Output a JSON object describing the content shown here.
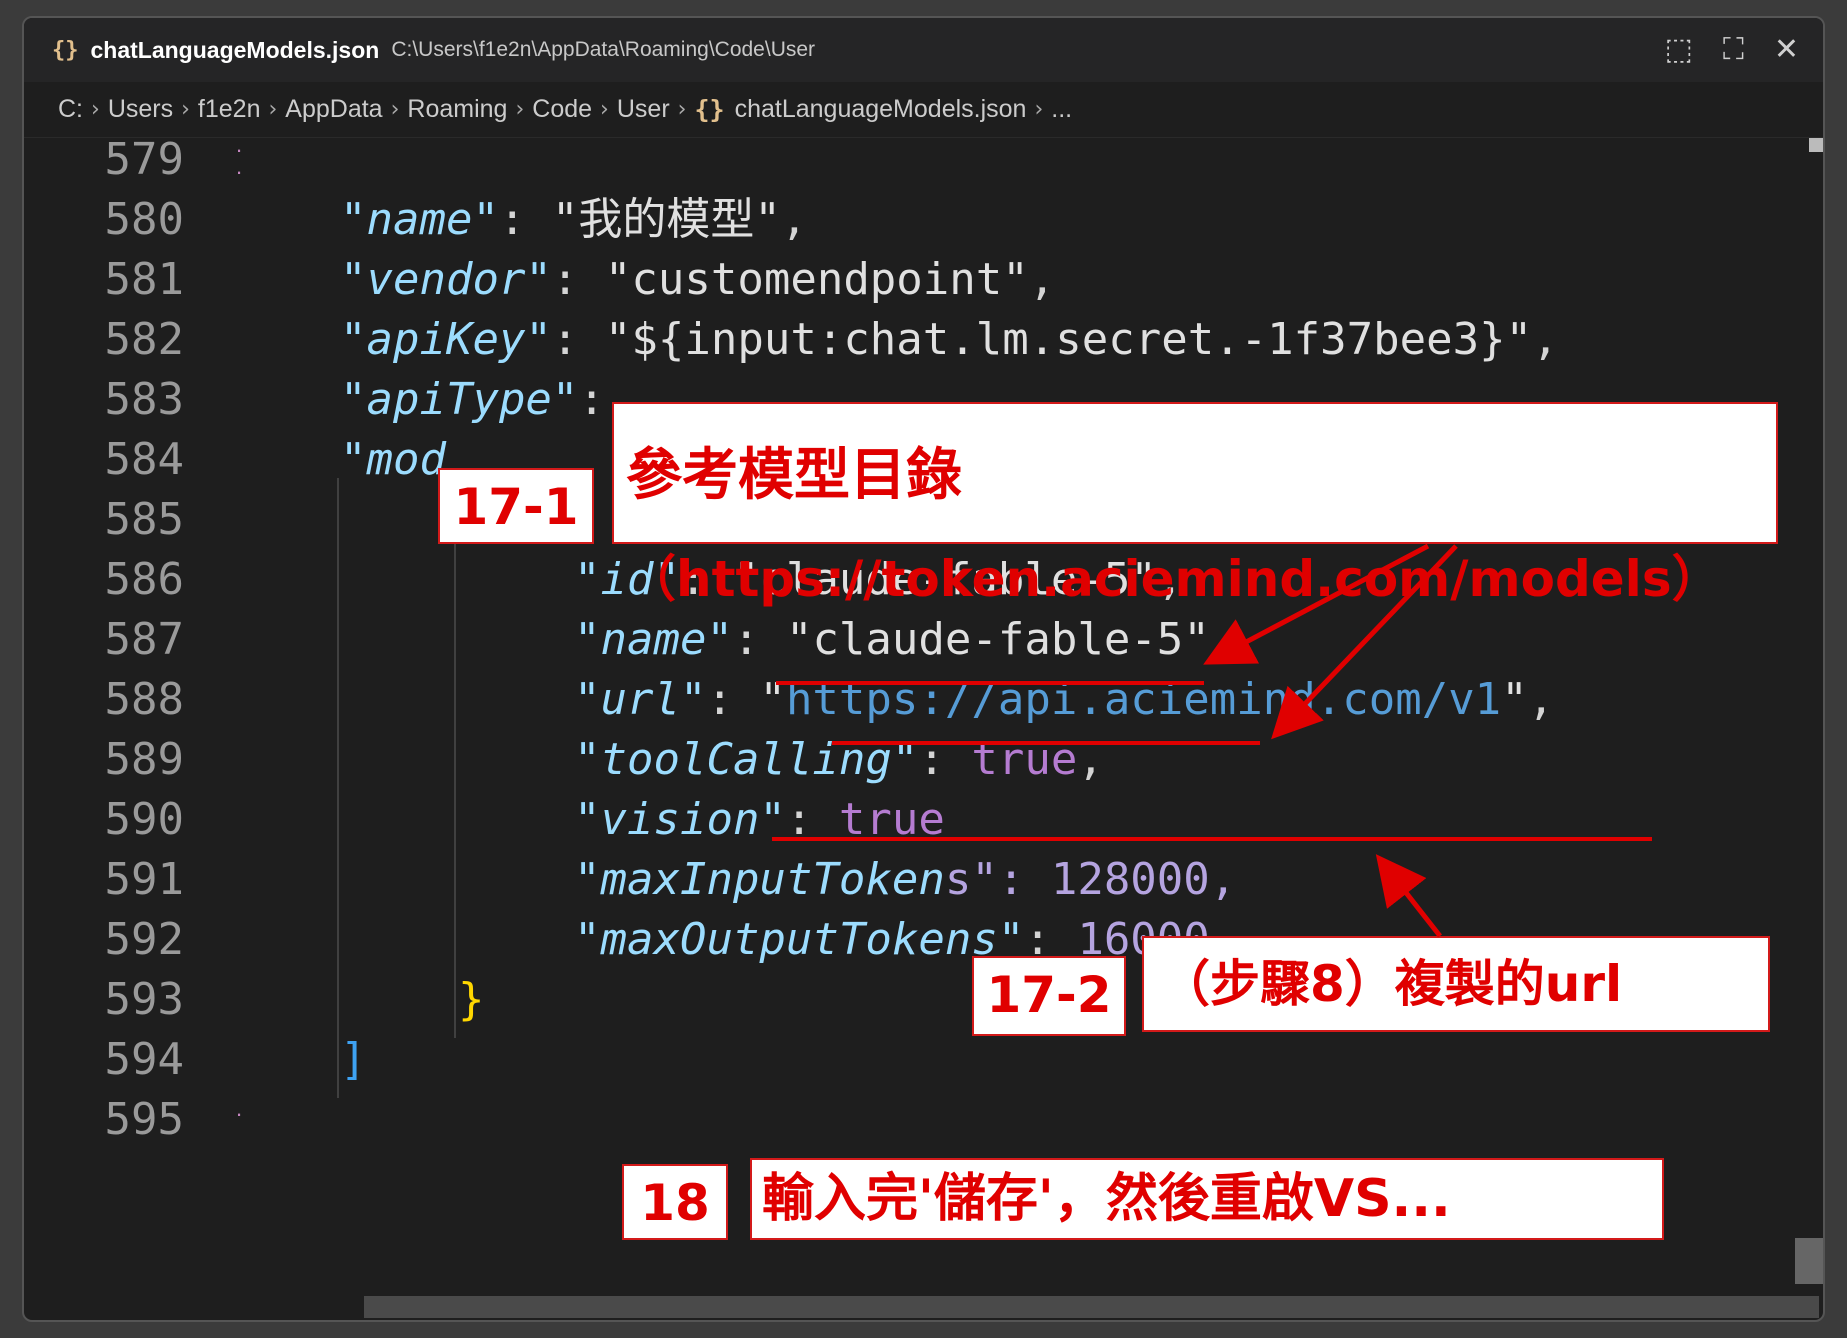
{
  "window": {
    "title_icon": "{}",
    "filename": "chatLanguageModels.json",
    "path": "C:\\Users\\f1e2n\\AppData\\Roaming\\Code\\User",
    "actions": [
      "select-region-icon",
      "fullscreen-icon",
      "close-icon"
    ]
  },
  "breadcrumb": {
    "items": [
      "C:",
      "Users",
      "f1e2n",
      "AppData",
      "Roaming",
      "Code",
      "User"
    ],
    "json_icon": "{}",
    "file": "chatLanguageModels.json",
    "more": "..."
  },
  "editor": {
    "line_numbers": [
      "579",
      "580",
      "581",
      "582",
      "583",
      "584",
      "585",
      "586",
      "587",
      "588",
      "589",
      "590",
      "591",
      "592",
      "593",
      "594",
      "595"
    ],
    "lines": {
      "l580": {
        "key": "\"name\"",
        "sep": ": ",
        "val": "\"我的模型\"",
        "end": ","
      },
      "l581": {
        "key": "\"vendor\"",
        "sep": ": ",
        "val": "\"customendpoint\"",
        "end": ","
      },
      "l582": {
        "key": "\"apiKey\"",
        "sep": ": ",
        "val": "\"${input:chat.lm.secret.-1f37bee3}\"",
        "end": ","
      },
      "l583": {
        "key": "\"apiType\"",
        "sep": ":"
      },
      "l584": {
        "key": "\"mod"
      },
      "l585": {
        "brace": "{"
      },
      "l586": {
        "key": "\"id\"",
        "sep": ": ",
        "q1": "\"",
        "val": "claude-fable-5",
        "q2": "\"",
        "end": ","
      },
      "l587": {
        "key": "\"name\"",
        "sep": ": ",
        "q1": "\"",
        "val": "claude-fable-5",
        "q2": "\"",
        "end": ","
      },
      "l588": {
        "key": "\"url\"",
        "sep": ": ",
        "q1": "\"",
        "val": "https://api.aciemind.com/v1",
        "q2": "\"",
        "end": ","
      },
      "l589": {
        "key": "\"toolCalling\"",
        "sep": ": ",
        "val": "true",
        "end": ","
      },
      "l590": {
        "key": "\"vision\"",
        "sep": ": ",
        "val": "true"
      },
      "l591": {
        "key": "\"maxInputToken",
        "tail": "s\": 128000,"
      },
      "l592": {
        "key": "\"maxOutputTokens\"",
        "sep": ": ",
        "val": "16000"
      },
      "l593": {
        "brace": "}"
      },
      "l594": {
        "bracket": "]"
      }
    }
  },
  "annotations": {
    "tag_17_1": "17-1",
    "callout_17_1_line1": "參考模型目錄",
    "callout_17_1_line2": "（https://token.aciemind.com/models）",
    "tag_17_2": "17-2",
    "callout_17_2": "（步驟8）複製的url",
    "tag_18": "18",
    "callout_18": "輸入完'儲存'，然後重啟VS...",
    "color": "#e00000"
  }
}
